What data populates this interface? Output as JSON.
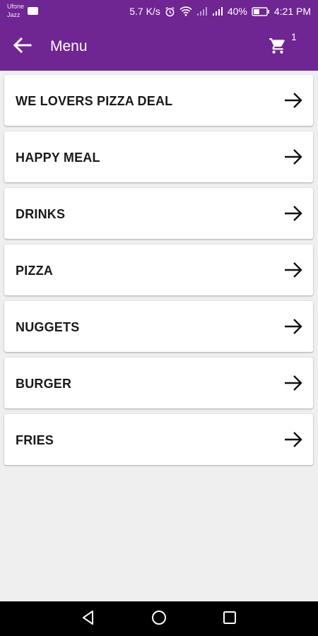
{
  "status_bar": {
    "carrier_line1": "Ufone",
    "carrier_line2": "Jazz",
    "speed": "5.7 K/s",
    "battery": "40%",
    "time": "4:21 PM"
  },
  "app_bar": {
    "title": "Menu",
    "cart_count": "1"
  },
  "menu": {
    "items": [
      {
        "label": "WE LOVERS PIZZA DEAL"
      },
      {
        "label": "HAPPY MEAL"
      },
      {
        "label": "DRINKS"
      },
      {
        "label": "PIZZA"
      },
      {
        "label": "NUGGETS"
      },
      {
        "label": "BURGER"
      },
      {
        "label": "FRIES"
      }
    ]
  },
  "colors": {
    "primary": "#6f2592",
    "background": "#efefef",
    "card": "#ffffff",
    "text": "#1a1a1a"
  },
  "icons": {
    "back": "arrow-left-icon",
    "cart": "shopping-cart-icon",
    "item_arrow": "arrow-right-icon",
    "nav_back": "triangle-back-icon",
    "nav_home": "circle-home-icon",
    "nav_recents": "square-recents-icon"
  }
}
